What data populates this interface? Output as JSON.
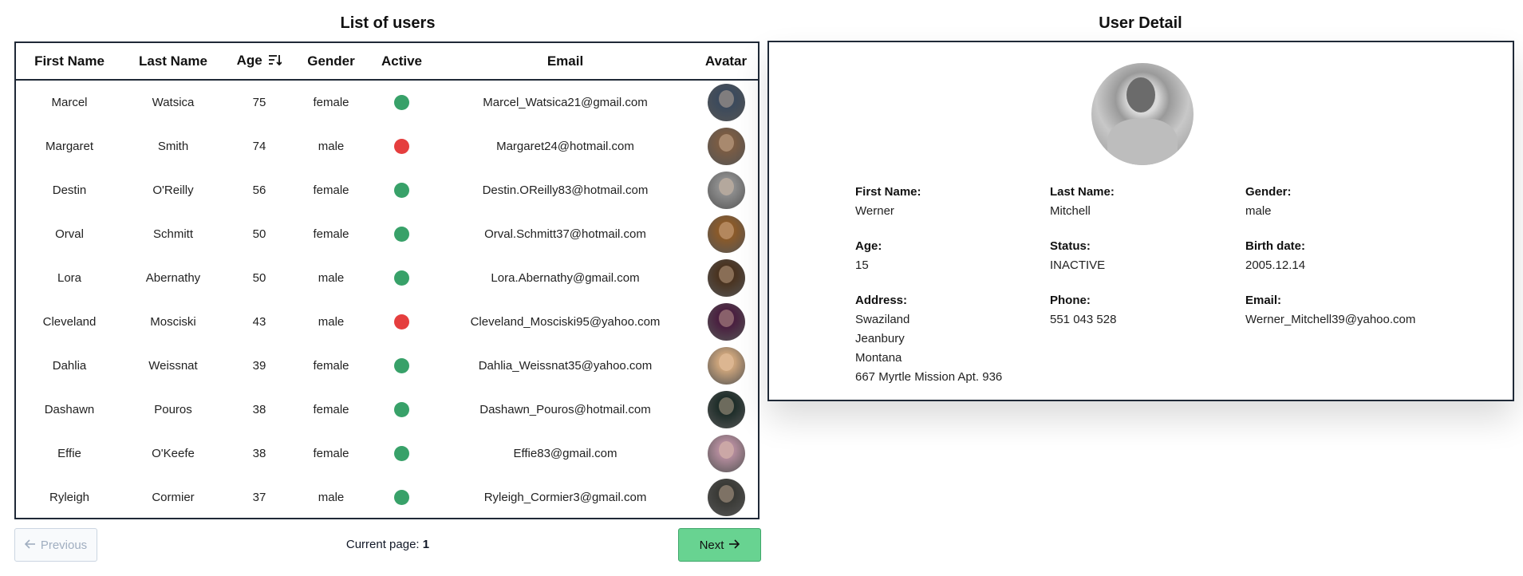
{
  "list": {
    "title": "List of users",
    "columns": [
      "First Name",
      "Last Name",
      "Age",
      "Gender",
      "Active",
      "Email",
      "Avatar"
    ],
    "sorted_column": "Age",
    "rows": [
      {
        "first": "Marcel",
        "last": "Watsica",
        "age": "75",
        "gender": "female",
        "active": true,
        "email": "Marcel_Watsica21@gmail.com",
        "avatar_color": "#3c4a5c"
      },
      {
        "first": "Margaret",
        "last": "Smith",
        "age": "74",
        "gender": "male",
        "active": false,
        "email": "Margaret24@hotmail.com",
        "avatar_color": "#7a5c44"
      },
      {
        "first": "Destin",
        "last": "O'Reilly",
        "age": "56",
        "gender": "female",
        "active": true,
        "email": "Destin.OReilly83@hotmail.com",
        "avatar_color": "#8c8c8c"
      },
      {
        "first": "Orval",
        "last": "Schmitt",
        "age": "50",
        "gender": "female",
        "active": true,
        "email": "Orval.Schmitt37@hotmail.com",
        "avatar_color": "#8a5a2a"
      },
      {
        "first": "Lora",
        "last": "Abernathy",
        "age": "50",
        "gender": "male",
        "active": true,
        "email": "Lora.Abernathy@gmail.com",
        "avatar_color": "#4a3320"
      },
      {
        "first": "Cleveland",
        "last": "Mosciski",
        "age": "43",
        "gender": "male",
        "active": false,
        "email": "Cleveland_Mosciski95@yahoo.com",
        "avatar_color": "#4a2040"
      },
      {
        "first": "Dahlia",
        "last": "Weissnat",
        "age": "39",
        "gender": "female",
        "active": true,
        "email": "Dahlia_Weissnat35@yahoo.com",
        "avatar_color": "#c9a27a"
      },
      {
        "first": "Dashawn",
        "last": "Pouros",
        "age": "38",
        "gender": "female",
        "active": true,
        "email": "Dashawn_Pouros@hotmail.com",
        "avatar_color": "#1f2e2a"
      },
      {
        "first": "Effie",
        "last": "O'Keefe",
        "age": "38",
        "gender": "female",
        "active": true,
        "email": "Effie83@gmail.com",
        "avatar_color": "#b08a9a"
      },
      {
        "first": "Ryleigh",
        "last": "Cormier",
        "age": "37",
        "gender": "male",
        "active": true,
        "email": "Ryleigh_Cormier3@gmail.com",
        "avatar_color": "#3a3a36"
      }
    ],
    "status_colors": {
      "active": "#38a169",
      "inactive": "#e53e3e"
    }
  },
  "pagination": {
    "prev_label": "Previous",
    "next_label": "Next",
    "current_page_label": "Current page:",
    "current_page": "1",
    "prev_icon": "arrow-left-icon",
    "next_icon": "arrow-right-icon"
  },
  "detail": {
    "title": "User Detail",
    "first_name_label": "First Name:",
    "first_name": "Werner",
    "last_name_label": "Last Name:",
    "last_name": "Mitchell",
    "gender_label": "Gender:",
    "gender": "male",
    "age_label": "Age:",
    "age": "15",
    "status_label": "Status:",
    "status": "INACTIVE",
    "birth_label": "Birth date:",
    "birth_date": "2005.12.14",
    "address_label": "Address:",
    "address_country": "Swaziland",
    "address_city": "Jeanbury",
    "address_state": "Montana",
    "address_street": "667 Myrtle Mission Apt. 936",
    "phone_label": "Phone:",
    "phone": "551 043 528",
    "email_label": "Email:",
    "email": "Werner_Mitchell39@yahoo.com"
  }
}
